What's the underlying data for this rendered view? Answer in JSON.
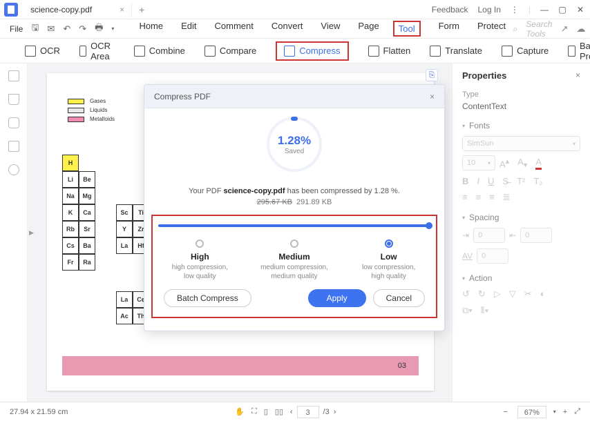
{
  "titlebar": {
    "filename": "science-copy.pdf",
    "feedback": "Feedback",
    "login": "Log In"
  },
  "menubar": {
    "file": "File",
    "items": {
      "home": "Home",
      "edit": "Edit",
      "comment": "Comment",
      "convert": "Convert",
      "view": "View",
      "page": "Page",
      "tool": "Tool",
      "form": "Form",
      "protect": "Protect"
    },
    "search_placeholder": "Search Tools"
  },
  "toolbar": {
    "ocr": "OCR",
    "ocr_area": "OCR Area",
    "combine": "Combine",
    "compare": "Compare",
    "compress": "Compress",
    "flatten": "Flatten",
    "translate": "Translate",
    "capture": "Capture",
    "batch": "Batch Process"
  },
  "document": {
    "legend": [
      "Gases",
      "Liquids",
      "Metalloids"
    ],
    "legend_colors": [
      "#fff04a",
      "#e8e8e8",
      "#ef8ab0"
    ],
    "rows": [
      [
        "H",
        "",
        ""
      ],
      [
        "Li",
        "Be",
        ""
      ],
      [
        "Na",
        "Mg",
        ""
      ],
      [
        "K",
        "Ca",
        ""
      ],
      [
        "Rb",
        "Sr",
        ""
      ],
      [
        "Cs",
        "Ba",
        ""
      ],
      [
        "Fr",
        "Ra",
        ""
      ]
    ],
    "col2": [
      [
        "Sc",
        "Ti"
      ],
      [
        "Y",
        "Zr"
      ],
      [
        "La",
        "Hf"
      ]
    ],
    "lanth": [
      [
        "La",
        "Ce"
      ],
      [
        "Ac",
        "Th"
      ]
    ],
    "page_footer": "03"
  },
  "props": {
    "title": "Properties",
    "type_lbl": "Type",
    "type_val": "ContentText",
    "fonts_lbl": "Fonts",
    "font_name": "SimSun",
    "font_size": "10",
    "spacing_lbl": "Spacing",
    "sp1": "0",
    "sp2": "0",
    "sp3": "0",
    "action_lbl": "Action"
  },
  "dialog": {
    "title": "Compress PDF",
    "pct": "1.28%",
    "saved": "Saved",
    "msg_pre": "Your PDF ",
    "msg_file": "science-copy.pdf",
    "msg_mid": "  has been compressed by  ",
    "msg_pct": "1.28 %",
    "old_size": "295.67 KB",
    "new_size": "291.89 KB",
    "opts": [
      {
        "name": "High",
        "desc": "high compression,\nlow quality"
      },
      {
        "name": "Medium",
        "desc": "medium compression,\nmedium quality"
      },
      {
        "name": "Low",
        "desc": "low compression,\nhigh quality"
      }
    ],
    "selected": 2,
    "batch": "Batch Compress",
    "apply": "Apply",
    "cancel": "Cancel"
  },
  "statusbar": {
    "dim": "27.94 x 21.59 cm",
    "page": "3",
    "total": "/3",
    "zoom": "67%"
  }
}
